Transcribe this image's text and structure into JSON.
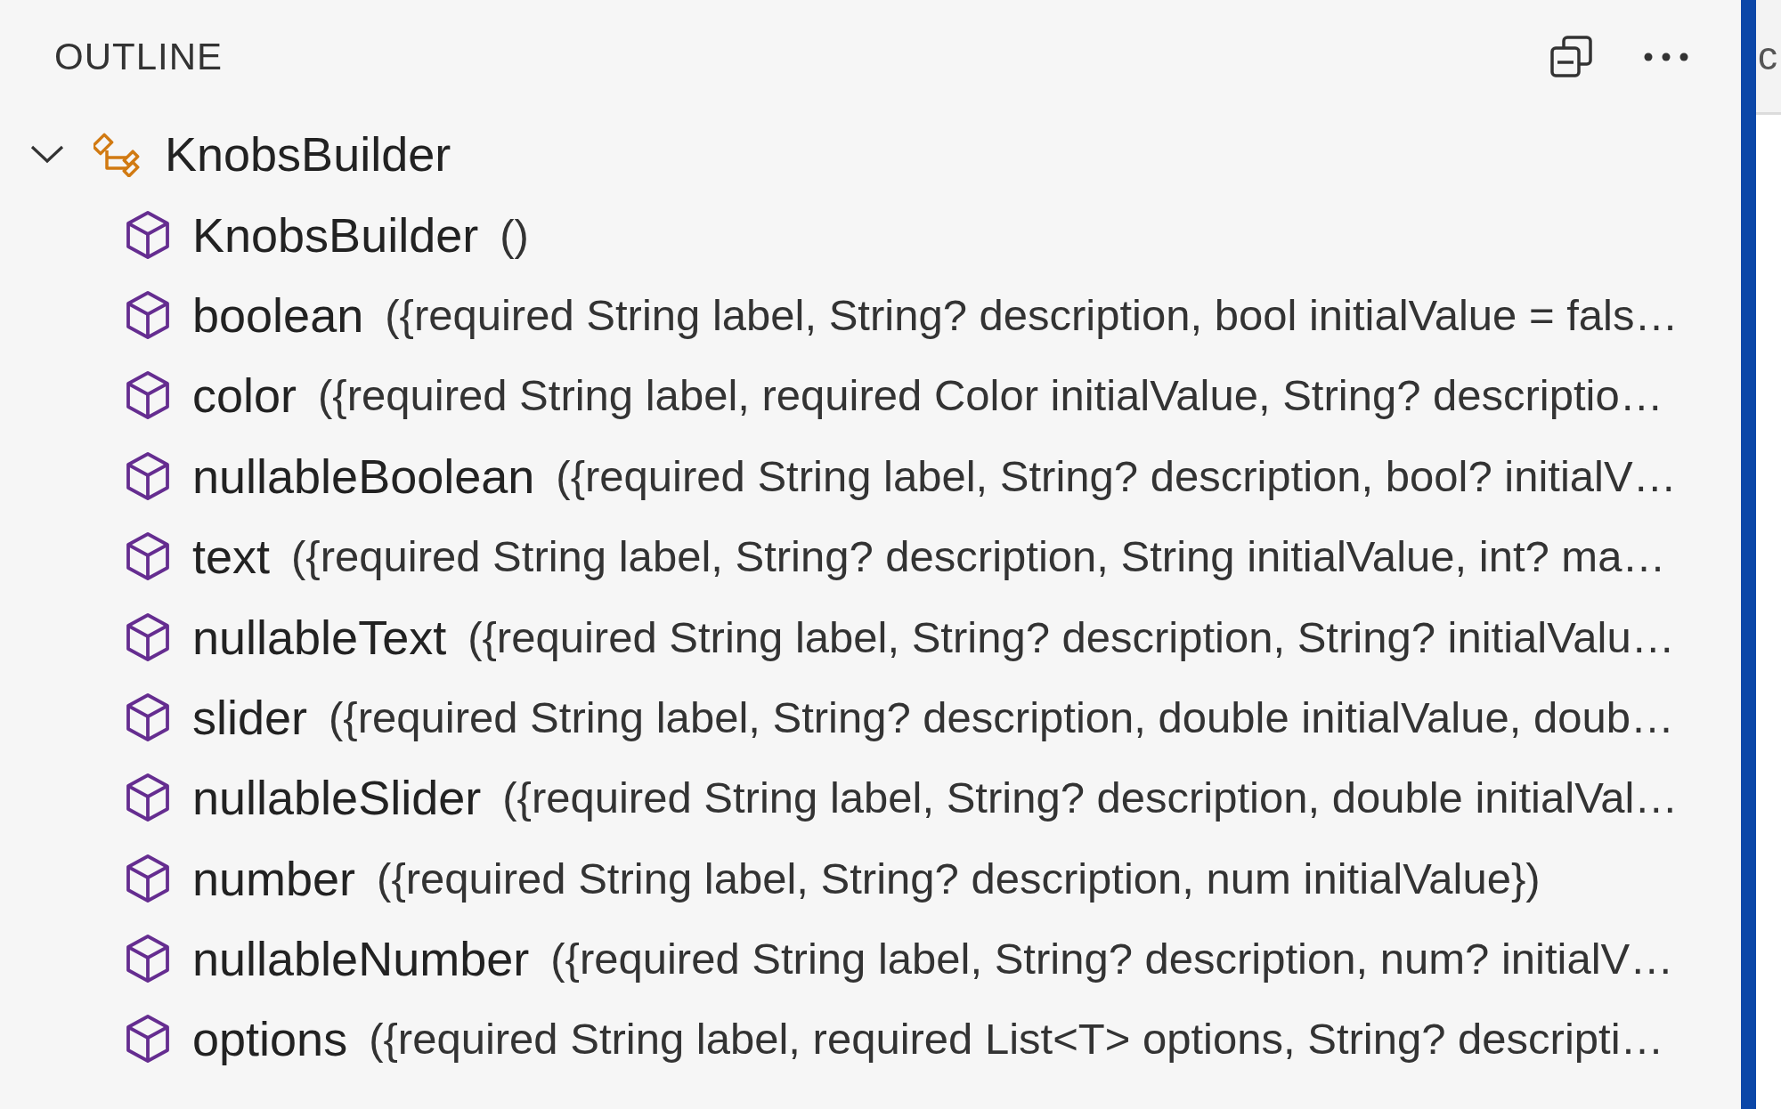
{
  "panel": {
    "title": "OUTLINE"
  },
  "outline": [
    {
      "name": "KnobsBuilder",
      "kind": "class",
      "expanded": true,
      "children": [
        {
          "name": "KnobsBuilder",
          "kind": "method",
          "detail": "()"
        },
        {
          "name": "boolean",
          "kind": "method",
          "detail": "({required String label, String? description, bool initialValue = fals…"
        },
        {
          "name": "color",
          "kind": "method",
          "detail": "({required String label, required Color initialValue, String? descriptio…"
        },
        {
          "name": "nullableBoolean",
          "kind": "method",
          "detail": "({required String label, String? description, bool? initialV…"
        },
        {
          "name": "text",
          "kind": "method",
          "detail": "({required String label, String? description, String initialValue, int? ma…"
        },
        {
          "name": "nullableText",
          "kind": "method",
          "detail": "({required String label, String? description, String? initialValu…"
        },
        {
          "name": "slider",
          "kind": "method",
          "detail": "({required String label, String? description, double initialValue, doub…"
        },
        {
          "name": "nullableSlider",
          "kind": "method",
          "detail": "({required String label, String? description, double initialVal…"
        },
        {
          "name": "number",
          "kind": "method",
          "detail": "({required String label, String? description, num initialValue})"
        },
        {
          "name": "nullableNumber",
          "kind": "method",
          "detail": "({required String label, String? description, num? initialV…"
        },
        {
          "name": "options",
          "kind": "method",
          "detail": "({required String label, required List<T> options, String? descripti…"
        }
      ]
    }
  ],
  "editor_tab": {
    "label": "c"
  }
}
